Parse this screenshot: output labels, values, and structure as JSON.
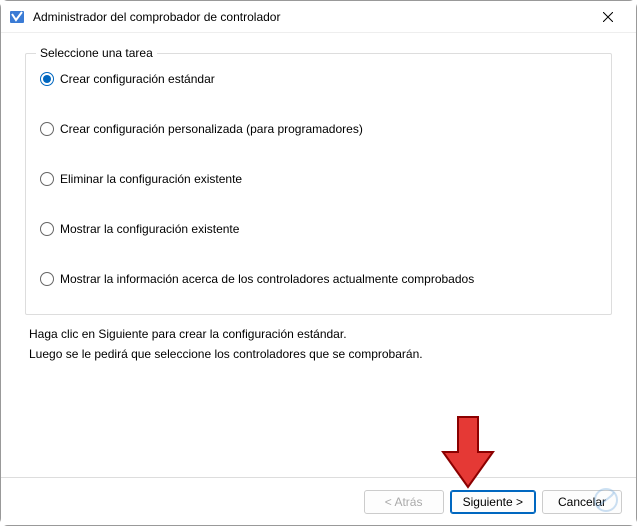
{
  "window": {
    "title": "Administrador del comprobador de controlador"
  },
  "fieldset": {
    "legend": "Seleccione una tarea",
    "options": [
      {
        "label": "Crear configuración estándar",
        "selected": true
      },
      {
        "label": "Crear configuración personalizada (para programadores)",
        "selected": false
      },
      {
        "label": "Eliminar la configuración existente",
        "selected": false
      },
      {
        "label": "Mostrar la configuración existente",
        "selected": false
      },
      {
        "label": "Mostrar la información acerca de los controladores actualmente comprobados",
        "selected": false
      }
    ]
  },
  "info": {
    "line1": "Haga clic en Siguiente para crear la configuración estándar.",
    "line2": "Luego se le pedirá que seleccione los controladores que se comprobarán."
  },
  "buttons": {
    "back": "< Atrás",
    "next": "Siguiente >",
    "cancel": "Cancelar"
  }
}
